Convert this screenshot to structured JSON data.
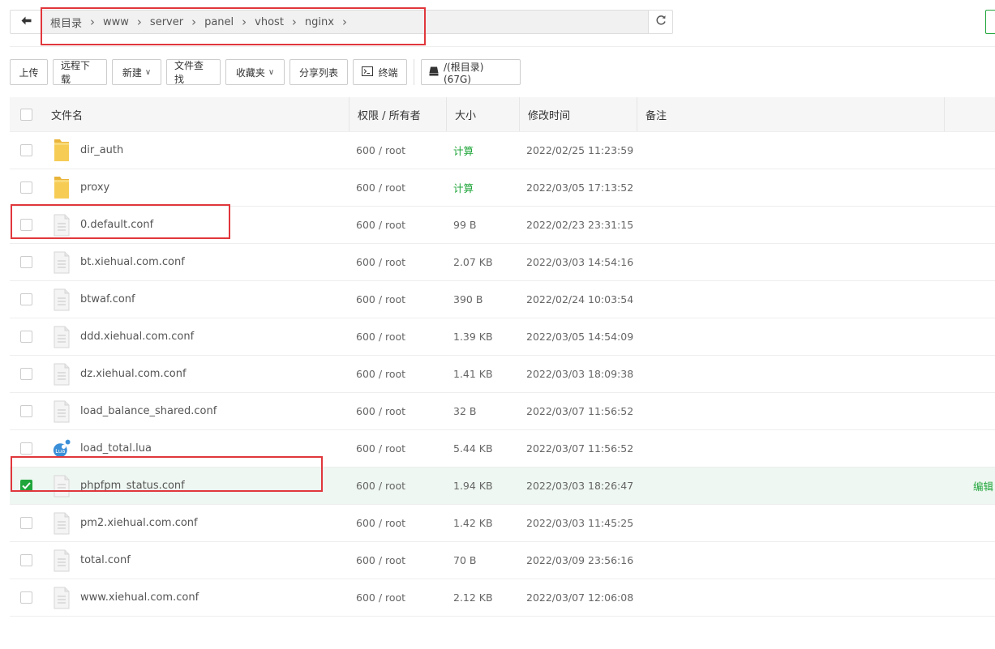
{
  "breadcrumb": {
    "items": [
      "根目录",
      "www",
      "server",
      "panel",
      "vhost",
      "nginx"
    ]
  },
  "toolbar": {
    "upload": "上传",
    "remote_download": "远程下载",
    "new": "新建",
    "file_search": "文件查找",
    "favorites": "收藏夹",
    "share_list": "分享列表",
    "terminal": "终端",
    "disk": "/(根目录) (67G)"
  },
  "table": {
    "headers": {
      "name": "文件名",
      "perm": "权限 / 所有者",
      "size": "大小",
      "mtime": "修改时间",
      "note": "备注"
    },
    "edit_label": "编辑",
    "rows": [
      {
        "name": "dir_auth",
        "type": "folder",
        "perm": "600 / root",
        "size": "计算",
        "mtime": "2022/02/25 11:23:59",
        "checked": false
      },
      {
        "name": "proxy",
        "type": "folder",
        "perm": "600 / root",
        "size": "计算",
        "mtime": "2022/03/05 17:13:52",
        "checked": false
      },
      {
        "name": "0.default.conf",
        "type": "file",
        "perm": "600 / root",
        "size": "99 B",
        "mtime": "2022/02/23 23:31:15",
        "checked": false
      },
      {
        "name": "bt.xiehual.com.conf",
        "type": "file",
        "perm": "600 / root",
        "size": "2.07 KB",
        "mtime": "2022/03/03 14:54:16",
        "checked": false
      },
      {
        "name": "btwaf.conf",
        "type": "file",
        "perm": "600 / root",
        "size": "390 B",
        "mtime": "2022/02/24 10:03:54",
        "checked": false
      },
      {
        "name": "ddd.xiehual.com.conf",
        "type": "file",
        "perm": "600 / root",
        "size": "1.39 KB",
        "mtime": "2022/03/05 14:54:09",
        "checked": false
      },
      {
        "name": "dz.xiehual.com.conf",
        "type": "file",
        "perm": "600 / root",
        "size": "1.41 KB",
        "mtime": "2022/03/03 18:09:38",
        "checked": false
      },
      {
        "name": "load_balance_shared.conf",
        "type": "file",
        "perm": "600 / root",
        "size": "32 B",
        "mtime": "2022/03/07 11:56:52",
        "checked": false
      },
      {
        "name": "load_total.lua",
        "type": "lua",
        "perm": "600 / root",
        "size": "5.44 KB",
        "mtime": "2022/03/07 11:56:52",
        "checked": false
      },
      {
        "name": "phpfpm_status.conf",
        "type": "file",
        "perm": "600 / root",
        "size": "1.94 KB",
        "mtime": "2022/03/03 18:26:47",
        "checked": true
      },
      {
        "name": "pm2.xiehual.com.conf",
        "type": "file",
        "perm": "600 / root",
        "size": "1.42 KB",
        "mtime": "2022/03/03 11:45:25",
        "checked": false
      },
      {
        "name": "total.conf",
        "type": "file",
        "perm": "600 / root",
        "size": "70 B",
        "mtime": "2022/03/09 23:56:16",
        "checked": false
      },
      {
        "name": "www.xiehual.com.conf",
        "type": "file",
        "perm": "600 / root",
        "size": "2.12 KB",
        "mtime": "2022/03/07 12:06:08",
        "checked": false
      }
    ]
  },
  "lua_badge": "Lua",
  "colors": {
    "accent": "#20a53a",
    "highlight": "#e0373c",
    "folder": "#f5c84c"
  }
}
